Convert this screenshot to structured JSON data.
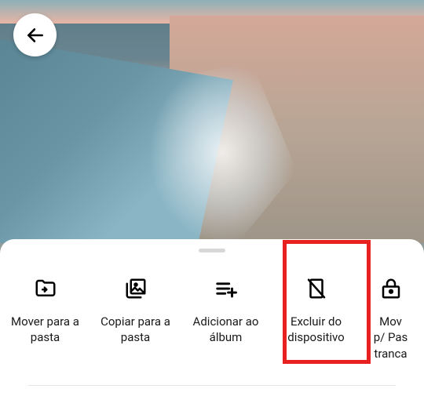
{
  "actions": {
    "move_folder": {
      "label": "Mover para a pasta"
    },
    "copy_folder": {
      "label": "Copiar para a pasta"
    },
    "add_album": {
      "label": "Adicionar ao álbum"
    },
    "delete_device": {
      "label": "Excluir do dispositivo"
    },
    "move_locked": {
      "label": "Mover p/ Pasta trancada"
    },
    "move_locked_partial": {
      "label_line1": "Mov",
      "label_line2": "p/ Pas",
      "label_line3": "tranca"
    }
  }
}
